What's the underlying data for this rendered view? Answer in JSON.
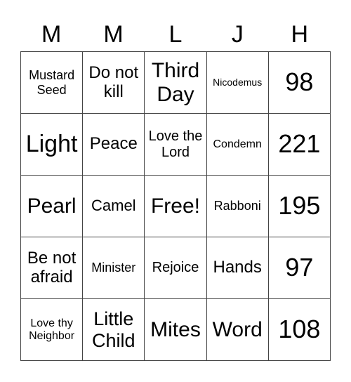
{
  "header": {
    "letters": [
      "M",
      "M",
      "L",
      "J",
      "H"
    ]
  },
  "grid": {
    "rows": [
      [
        "Mustard Seed",
        "Do not kill",
        "Third Day",
        "Nicodemus",
        "98"
      ],
      [
        "Light",
        "Peace",
        "Love the Lord",
        "Condemn",
        "221"
      ],
      [
        "Pearl",
        "Camel",
        "Free!",
        "Rabboni",
        "195"
      ],
      [
        "Be not afraid",
        "Minister",
        "Rejoice",
        "Hands",
        "97"
      ],
      [
        "Love thy Neighbor",
        "Little Child",
        "Mites",
        "Word",
        "108"
      ]
    ]
  }
}
